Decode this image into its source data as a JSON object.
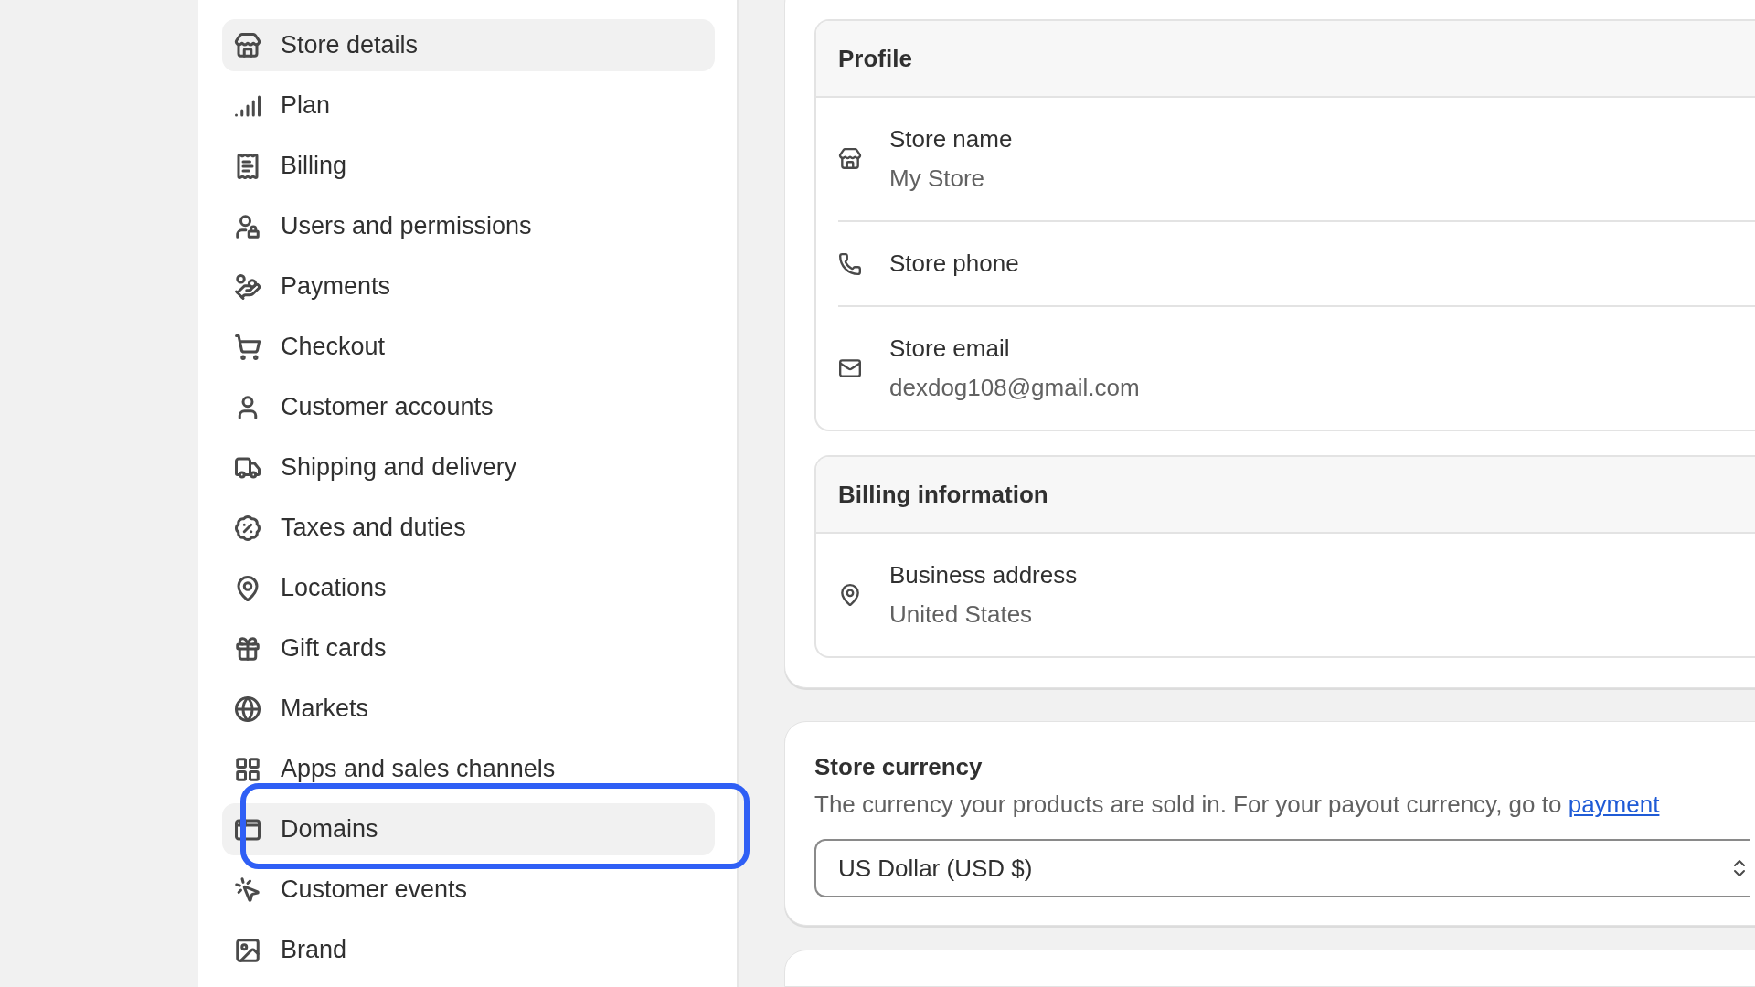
{
  "sidebar": {
    "items": [
      {
        "label": "Store details",
        "highlighted": true
      },
      {
        "label": "Plan",
        "highlighted": false
      },
      {
        "label": "Billing",
        "highlighted": false
      },
      {
        "label": "Users and permissions",
        "highlighted": false
      },
      {
        "label": "Payments",
        "highlighted": false
      },
      {
        "label": "Checkout",
        "highlighted": false
      },
      {
        "label": "Customer accounts",
        "highlighted": false
      },
      {
        "label": "Shipping and delivery",
        "highlighted": false
      },
      {
        "label": "Taxes and duties",
        "highlighted": false
      },
      {
        "label": "Locations",
        "highlighted": false
      },
      {
        "label": "Gift cards",
        "highlighted": false
      },
      {
        "label": "Markets",
        "highlighted": false
      },
      {
        "label": "Apps and sales channels",
        "highlighted": false
      },
      {
        "label": "Domains",
        "highlighted": true,
        "framed": true
      },
      {
        "label": "Customer events",
        "highlighted": false
      },
      {
        "label": "Brand",
        "highlighted": false
      }
    ]
  },
  "profile": {
    "title": "Profile",
    "rows": [
      {
        "kind": "store",
        "label": "Store name",
        "value": "My Store"
      },
      {
        "kind": "phone",
        "label": "Store phone"
      },
      {
        "kind": "email",
        "label": "Store email",
        "value": "dexdog108@gmail.com"
      }
    ]
  },
  "billing_information": {
    "title": "Billing information",
    "rows": [
      {
        "kind": "address",
        "label": "Business address",
        "value": "United States"
      }
    ]
  },
  "store_currency": {
    "title": "Store currency",
    "description": "The currency your products are sold in. For your payout currency, go to",
    "link": "payment",
    "select_value": "US Dollar (USD $)"
  }
}
